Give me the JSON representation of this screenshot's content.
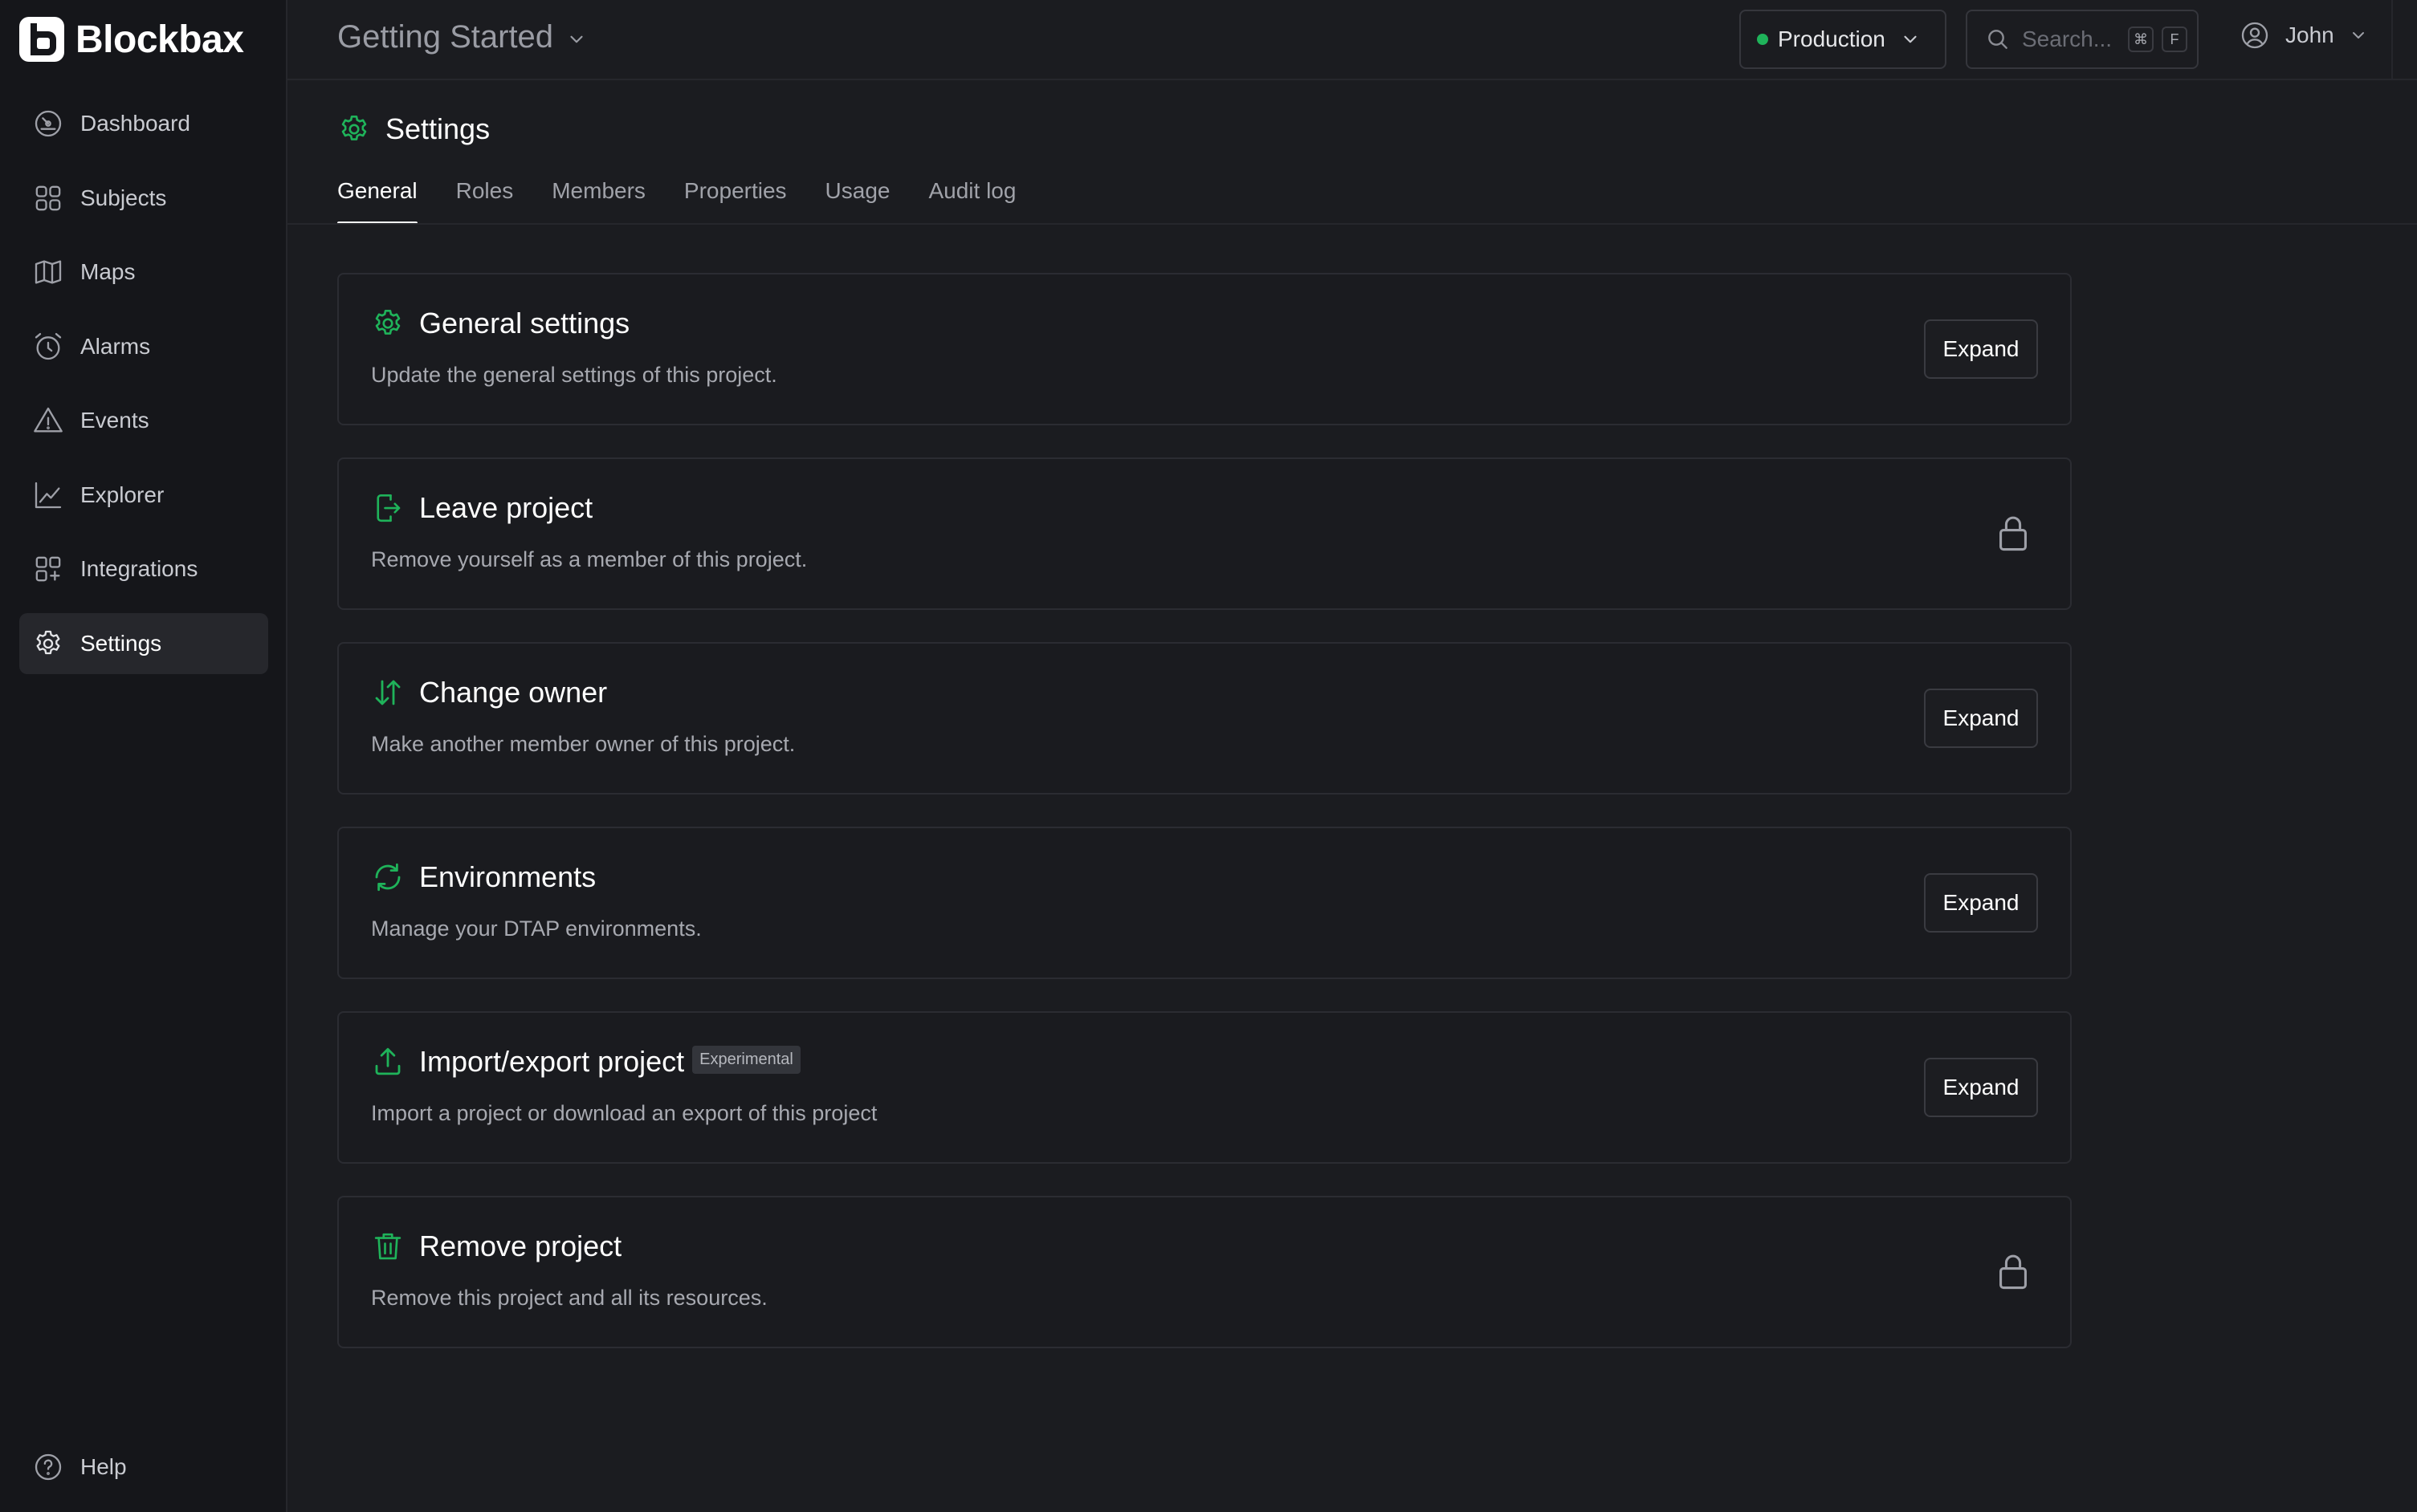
{
  "app": {
    "name": "Blockbax"
  },
  "sidebar": {
    "items": [
      {
        "label": "Dashboard",
        "icon": "gauge-icon"
      },
      {
        "label": "Subjects",
        "icon": "grid-icon"
      },
      {
        "label": "Maps",
        "icon": "map-icon"
      },
      {
        "label": "Alarms",
        "icon": "alarm-clock-icon"
      },
      {
        "label": "Events",
        "icon": "warning-triangle-icon"
      },
      {
        "label": "Explorer",
        "icon": "line-chart-icon"
      },
      {
        "label": "Integrations",
        "icon": "integrations-icon"
      },
      {
        "label": "Settings",
        "icon": "gear-icon",
        "active": true
      }
    ],
    "help_label": "Help"
  },
  "header": {
    "project_title": "Getting Started",
    "environment": {
      "label": "Production",
      "status_color": "#1fb35a"
    },
    "search": {
      "placeholder": "Search...",
      "shortcut_keys": [
        "⌘",
        "F"
      ]
    },
    "user": {
      "name": "John"
    }
  },
  "page": {
    "title": "Settings",
    "tabs": [
      {
        "label": "General",
        "active": true
      },
      {
        "label": "Roles"
      },
      {
        "label": "Members"
      },
      {
        "label": "Properties"
      },
      {
        "label": "Usage"
      },
      {
        "label": "Audit log"
      }
    ]
  },
  "cards": [
    {
      "title": "General settings",
      "description": "Update the general settings of this project.",
      "action": "Expand",
      "icon": "gear-icon"
    },
    {
      "title": "Leave project",
      "description": "Remove yourself as a member of this project.",
      "locked": true,
      "icon": "exit-icon"
    },
    {
      "title": "Change owner",
      "description": "Make another member owner of this project.",
      "action": "Expand",
      "icon": "swap-arrows-icon"
    },
    {
      "title": "Environments",
      "description": "Manage your DTAP environments.",
      "action": "Expand",
      "icon": "refresh-icon"
    },
    {
      "title": "Import/export project",
      "badge": "Experimental",
      "description": "Import a project or download an export of this project",
      "action": "Expand",
      "icon": "upload-icon"
    },
    {
      "title": "Remove project",
      "description": "Remove this project and all its resources.",
      "locked": true,
      "icon": "trash-icon"
    }
  ],
  "colors": {
    "accent": "#1fb35a",
    "background": "#1b1c20",
    "sidebar": "#15161a",
    "text_primary": "#ffffff",
    "text_secondary": "#a7a9b0"
  }
}
